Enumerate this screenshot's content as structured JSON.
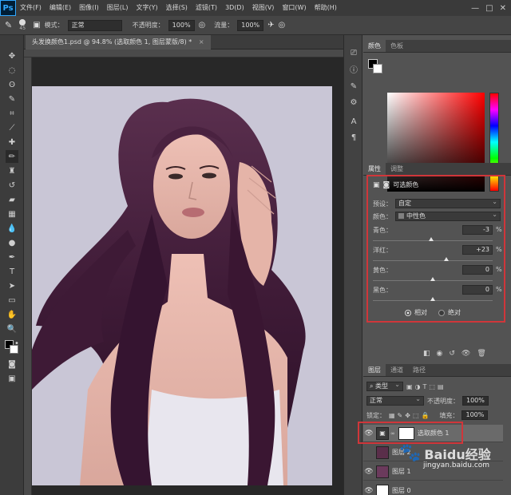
{
  "app": {
    "logo": "Ps"
  },
  "menubar": [
    "文件(F)",
    "编辑(E)",
    "图像(I)",
    "图层(L)",
    "文字(Y)",
    "选择(S)",
    "滤镜(T)",
    "3D(D)",
    "视图(V)",
    "窗口(W)",
    "帮助(H)"
  ],
  "options": {
    "brush_size": "45",
    "mode_label": "模式：",
    "mode_value": "正常",
    "opacity_label": "不透明度：",
    "opacity_value": "100%",
    "flow_label": "流量：",
    "flow_value": "100%"
  },
  "document": {
    "tab_title": "头发换颜色1.psd @ 94.8% (选取颜色 1, 图层蒙版/8) *"
  },
  "color_panel": {
    "tabs": [
      "颜色",
      "色板"
    ],
    "fg": "#000000",
    "bg": "#ffffff"
  },
  "properties": {
    "tabs": [
      "属性",
      "调整"
    ],
    "title": "可选颜色",
    "preset_label": "预设：",
    "preset_value": "自定",
    "colors_label": "颜色：",
    "colors_value": "中性色",
    "sliders": [
      {
        "label": "青色：",
        "value": "-3",
        "unit": "%",
        "position": -3
      },
      {
        "label": "洋红：",
        "value": "+23",
        "unit": "%",
        "position": 23
      },
      {
        "label": "黄色：",
        "value": "0",
        "unit": "%",
        "position": 0
      },
      {
        "label": "黑色：",
        "value": "0",
        "unit": "%",
        "position": 0
      }
    ],
    "method_relative": "相对",
    "method_absolute": "绝对"
  },
  "layers": {
    "tabs": [
      "图层",
      "通道",
      "路径"
    ],
    "filter": "类型",
    "blend_mode": "正常",
    "opacity_label": "不透明度：",
    "opacity_value": "100%",
    "lock_label": "锁定：",
    "fill_label": "填充：",
    "fill_value": "100%",
    "rows": [
      {
        "name": "选取颜色 1"
      },
      {
        "name": "图层 2"
      },
      {
        "name": "图层 1"
      },
      {
        "name": "图层 0"
      }
    ]
  },
  "watermark": {
    "site": "jingyan.baidu.com",
    "brand": "Baidu经验"
  }
}
